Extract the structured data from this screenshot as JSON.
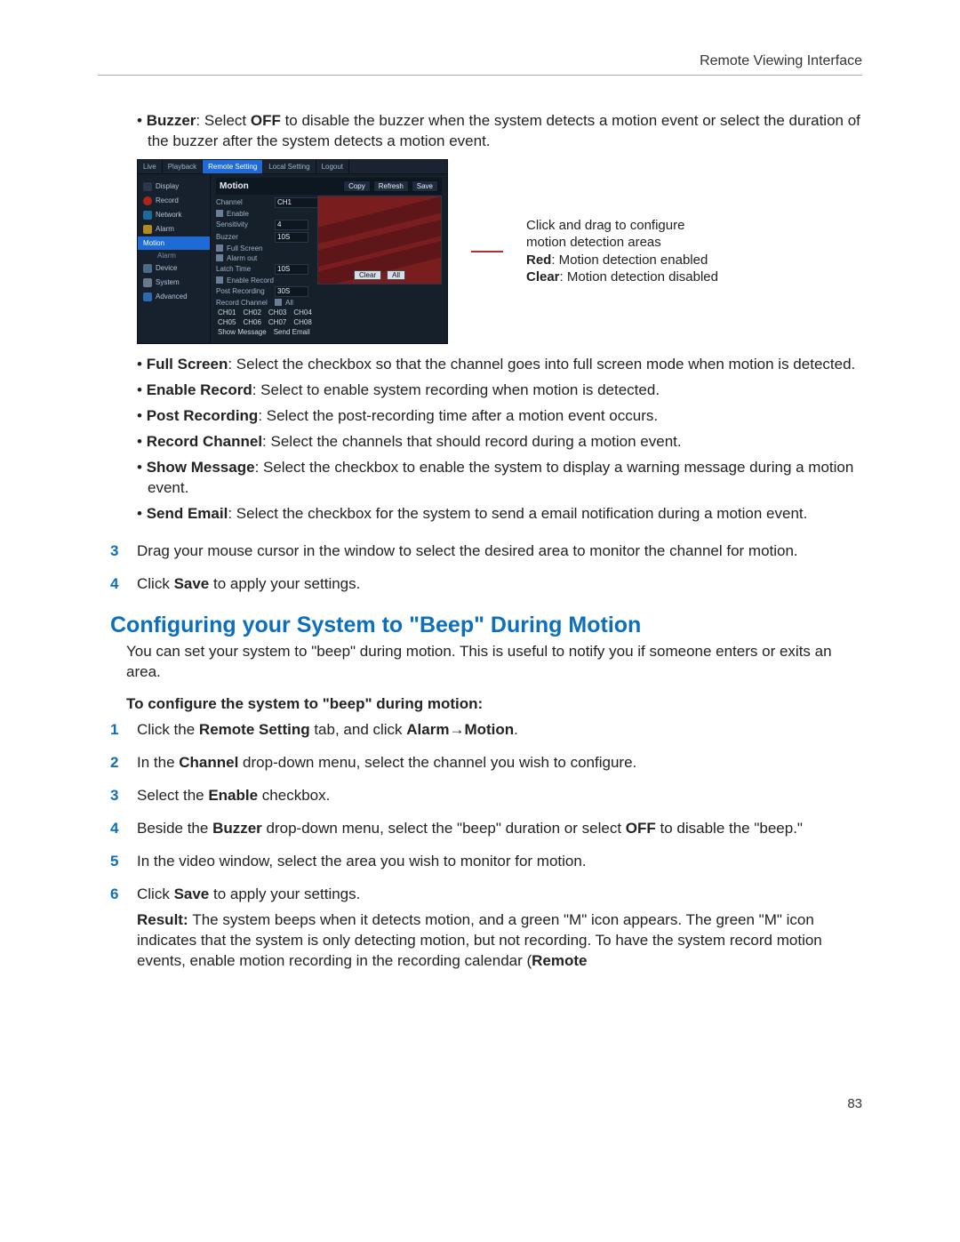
{
  "header": {
    "title": "Remote Viewing Interface"
  },
  "page_number": "83",
  "top_bullets": [
    {
      "term": "Buzzer",
      "text": ": Select ",
      "bold2": "OFF",
      "text2": " to disable the buzzer when the system detects a motion event or select the duration of the buzzer after the system detects a motion event."
    }
  ],
  "figure": {
    "tabs": [
      "Live",
      "Playback",
      "Remote Setting",
      "Local Setting",
      "Logout"
    ],
    "active_tab_index": 2,
    "sidebar": [
      {
        "kind": "disp",
        "label": "Display"
      },
      {
        "kind": "rec",
        "label": "Record"
      },
      {
        "kind": "net",
        "label": "Network"
      },
      {
        "kind": "alm",
        "label": "Alarm"
      },
      {
        "kind": "active",
        "label": "Motion"
      },
      {
        "kind": "sub",
        "label": "Alarm"
      },
      {
        "kind": "dev",
        "label": "Device"
      },
      {
        "kind": "sys",
        "label": "System"
      },
      {
        "kind": "adv",
        "label": "Advanced"
      }
    ],
    "panel_title": "Motion",
    "panel_buttons": [
      "Copy",
      "Refresh",
      "Save"
    ],
    "rows": {
      "channel_lbl": "Channel",
      "channel_val": "CH1",
      "enable_lbl": "Enable",
      "sensitivity_lbl": "Sensitivity",
      "sensitivity_val": "4",
      "buzzer_lbl": "Buzzer",
      "buzzer_val": "10S",
      "fullscreen_lbl": "Full Screen",
      "alarmout_lbl": "Alarm out",
      "latch_lbl": "Latch Time",
      "latch_val": "10S",
      "enablerec_lbl": "Enable Record",
      "postrec_lbl": "Post Recording",
      "postrec_val": "30S",
      "recch_lbl": "Record Channel",
      "recch_all": "All",
      "ch_list1": [
        "CH01",
        "CH02",
        "CH03",
        "CH04"
      ],
      "ch_list2": [
        "CH05",
        "CH06",
        "CH07",
        "CH08"
      ],
      "showmsg_lbl": "Show Message",
      "sendemail_lbl": "Send Email"
    },
    "grid_buttons": [
      "Clear",
      "All"
    ],
    "callout": {
      "line1": "Click and drag to configure",
      "line2": "motion detection areas",
      "line3a": "Red",
      "line3b": ": Motion detection enabled",
      "line4a": "Clear",
      "line4b": ": Motion detection disabled"
    }
  },
  "after_fig_bullets": [
    {
      "term": "Full Screen",
      "text": ": Select the checkbox so that the channel goes into full screen mode when motion is detected."
    },
    {
      "term": "Enable Record",
      "text": ": Select to enable system recording when motion is detected."
    },
    {
      "term": "Post Recording",
      "text": ": Select the post-recording time after a motion event occurs."
    },
    {
      "term": "Record Channel",
      "text": ": Select the channels that should record during a motion event."
    },
    {
      "term": "Show Message",
      "text": ": Select the checkbox to enable the system to display a warning message during a motion event."
    },
    {
      "term": "Send Email",
      "text": ": Select the checkbox for the system to send a email notification during a motion event."
    }
  ],
  "steps_a": [
    {
      "n": "3",
      "text": "Drag your mouse cursor in the window to select the desired area to monitor the channel for motion."
    },
    {
      "n": "4",
      "pre": "Click ",
      "bold": "Save",
      "post": " to apply your settings."
    }
  ],
  "section2": {
    "title": "Configuring your System to \"Beep\" During Motion",
    "intro": "You can set your system to \"beep\" during motion. This is useful to notify you if someone enters or exits an area.",
    "subhead": "To configure the system to \"beep\" during motion:"
  },
  "steps_b": [
    {
      "n": "1",
      "segments": [
        {
          "t": "Click the "
        },
        {
          "b": "Remote Setting"
        },
        {
          "t": " tab, and click "
        },
        {
          "b": "Alarm→Motion"
        },
        {
          "t": "."
        }
      ]
    },
    {
      "n": "2",
      "segments": [
        {
          "t": "In the "
        },
        {
          "b": "Channel"
        },
        {
          "t": " drop-down menu, select the channel you wish to configure."
        }
      ]
    },
    {
      "n": "3",
      "segments": [
        {
          "t": "Select the "
        },
        {
          "b": "Enable"
        },
        {
          "t": " checkbox."
        }
      ]
    },
    {
      "n": "4",
      "segments": [
        {
          "t": "Beside the "
        },
        {
          "b": "Buzzer"
        },
        {
          "t": " drop-down menu, select the \"beep\" duration or select "
        },
        {
          "b": "OFF"
        },
        {
          "t": " to disable the \"beep.\""
        }
      ]
    },
    {
      "n": "5",
      "segments": [
        {
          "t": "In the video window, select the area you wish to monitor for motion."
        }
      ]
    },
    {
      "n": "6",
      "segments": [
        {
          "t": "Click "
        },
        {
          "b": "Save"
        },
        {
          "t": " to apply your settings."
        }
      ],
      "extra": {
        "lead": "Result: ",
        "text": "The system beeps when it detects motion, and a green \"M\" icon appears. The green \"M\" icon indicates that the system is only detecting motion, but not recording. To have the system record motion events, enable motion recording in the recording calendar (",
        "tail_bold": "Remote"
      }
    }
  ]
}
